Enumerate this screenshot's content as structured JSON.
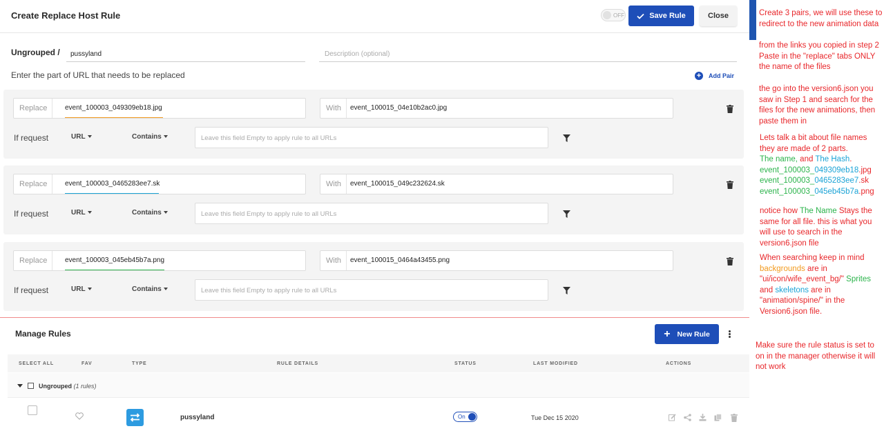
{
  "header": {
    "title": "Create Replace Host Rule",
    "status_toggle": "OFF",
    "save_label": "Save Rule",
    "close_label": "Close"
  },
  "rule": {
    "group": "Ungrouped /",
    "name": "pussyland",
    "description_placeholder": "Description (optional)",
    "instruction": "Enter the part of URL that needs to be replaced",
    "add_pair_label": "Add Pair"
  },
  "pairs": [
    {
      "replace_label": "Replace",
      "replace_value": "event_100003_049309eb18.jpg",
      "with_label": "With",
      "with_value": "event_100015_04e10b2ac0.jpg",
      "if_request": "If request",
      "source": "URL",
      "operator": "Contains",
      "condition_placeholder": "Leave this field Empty to apply rule to all URLs"
    },
    {
      "replace_label": "Replace",
      "replace_value": "event_100003_0465283ee7.sk",
      "with_label": "With",
      "with_value": "event_100015_049c232624.sk",
      "if_request": "If request",
      "source": "URL",
      "operator": "Contains",
      "condition_placeholder": "Leave this field Empty to apply rule to all URLs"
    },
    {
      "replace_label": "Replace",
      "replace_value": "event_100003_045eb45b7a.png",
      "with_label": "With",
      "with_value": "event_100015_0464a43455.png",
      "if_request": "If request",
      "source": "URL",
      "operator": "Contains",
      "condition_placeholder": "Leave this field Empty to apply rule to all URLs"
    }
  ],
  "manage": {
    "title": "Manage Rules",
    "new_rule_label": "New Rule",
    "columns": [
      "SELECT ALL",
      "FAV",
      "TYPE",
      "RULE DETAILS",
      "STATUS",
      "LAST MODIFIED",
      "ACTIONS"
    ],
    "group_name": "Ungrouped",
    "group_count": "(1 rules)",
    "row": {
      "name": "pussyland",
      "status": "On",
      "modified": "Tue Dec 15 2020"
    }
  },
  "notes": {
    "n1": "Create 3 pairs, we will use these to redirect to the new animation data",
    "n2": "from the links you copied in step 2 Paste in the \"replace\" tabs ONLY the name of the files",
    "n3": "the go into the version6.json you saw in Step 1 and search for the files for the new animations, then paste them in",
    "n4_a": "Lets talk a bit about file names they are made of 2 parts.",
    "n4_name": "The name,",
    "n4_and": " and ",
    "n4_hash": "The Hash",
    "n4_dot": ".",
    "f1_name": "event_100003_",
    "f1_hash": "049309eb18",
    "f1_ext": ".jpg",
    "f2_name": "event_100003_",
    "f2_hash": "0465283ee7",
    "f2_ext": ".sk",
    "f3_name": "event_100003_",
    "f3_hash": "045eb45b7a",
    "f3_ext": ".png",
    "n5_a": "notice how ",
    "n5_name": "The Name",
    "n5_b": " Stays the same for all file. this is what you will use to search in the version6.json file",
    "n6_a": "When searching keep in mind ",
    "n6_bg": "backgrounds",
    "n6_b": " are in \"ui/icon/wife_event_bg/\" ",
    "n6_sprites": "Sprites",
    "n6_c": " and ",
    "n6_skel": "skeletons",
    "n6_d": " are in \"animation/spine/\" in the Version6.json file.",
    "n7": "Make sure the rule status is set to on in the manager otherwise it will not work"
  },
  "colors": {
    "accent": "#1e4eb8",
    "note_red": "#e8262a",
    "note_green": "#2ab34a",
    "note_cyan": "#1aa3d6",
    "note_orange": "#f29a1e"
  }
}
